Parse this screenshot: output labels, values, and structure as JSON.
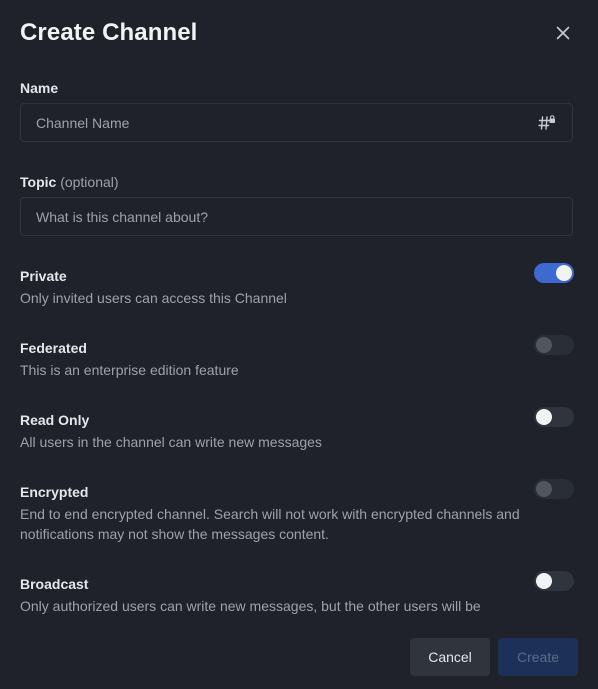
{
  "modal": {
    "title": "Create Channel",
    "close_icon": "close-icon"
  },
  "name_field": {
    "label": "Name",
    "placeholder": "Channel Name",
    "value": "",
    "icon": "hash-lock-icon"
  },
  "topic_field": {
    "label": "Topic",
    "optional": "(optional)",
    "placeholder": "What is this channel about?",
    "value": ""
  },
  "options": [
    {
      "title": "Private",
      "description": "Only invited users can access this Channel",
      "state": "on",
      "disabled": false
    },
    {
      "title": "Federated",
      "description": "This is an enterprise edition feature",
      "state": "off",
      "disabled": true
    },
    {
      "title": "Read Only",
      "description": "All users in the channel can write new messages",
      "state": "off",
      "disabled": false
    },
    {
      "title": "Encrypted",
      "description": "End to end encrypted channel. Search will not work with encrypted channels and notifications may not show the messages content.",
      "state": "off",
      "disabled": true
    },
    {
      "title": "Broadcast",
      "description": "Only authorized users can write new messages, but the other users will be",
      "state": "off",
      "disabled": false
    }
  ],
  "footer": {
    "cancel_label": "Cancel",
    "create_label": "Create"
  },
  "colors": {
    "background": "#1f222a",
    "accent": "#3d6ad1",
    "muted_text": "#9ea2a8"
  }
}
